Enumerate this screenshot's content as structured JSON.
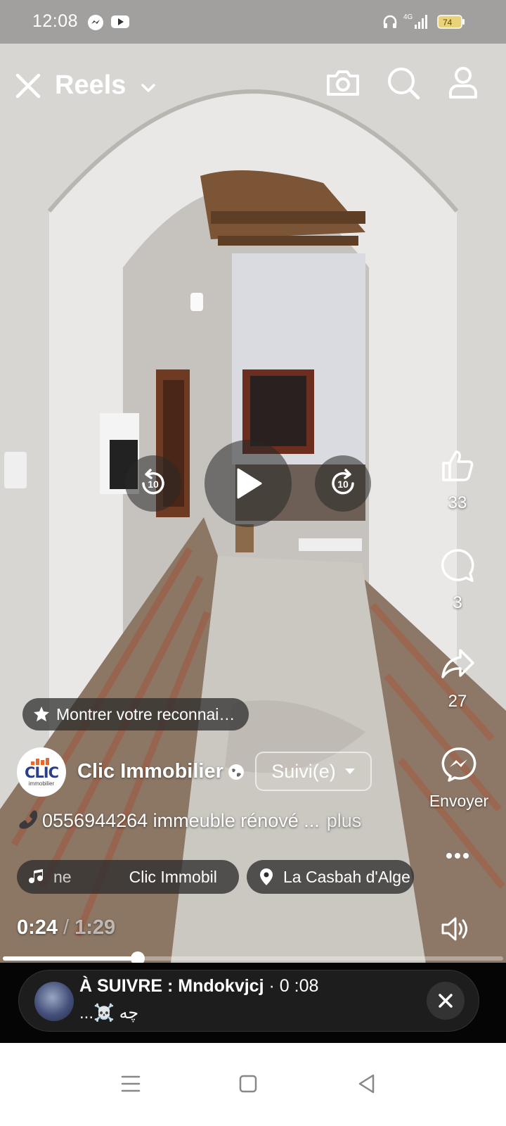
{
  "status_bar": {
    "time": "12:08",
    "network": "4G",
    "battery": "74"
  },
  "header": {
    "title": "Reels"
  },
  "player": {
    "current_time": "0:24",
    "separator": "/",
    "duration": "1:29",
    "progress_fraction": 0.27,
    "rewind_label": "10",
    "forward_label": "10"
  },
  "actions": {
    "like_count": "33",
    "comment_count": "3",
    "share_count": "27",
    "send_label": "Envoyer"
  },
  "recognition_chip": {
    "label": "Montrer votre reconnai…"
  },
  "author": {
    "avatar_text": "CLIC",
    "avatar_subtext": "immobilier",
    "name": "Clic Immobilier",
    "follow_label": "Suivi(e)"
  },
  "caption": {
    "text": "0556944264 immeuble rénové ...",
    "more": "plus"
  },
  "music_chip": {
    "scroll_text": "ne",
    "artist": "Clic Immobil"
  },
  "location_chip": {
    "label": "La Casbah d'Alge"
  },
  "up_next": {
    "label": "À SUIVRE : Mndokvjcj",
    "duration": "· 0 :08",
    "subtitle": "...☠️ چه"
  },
  "colors": {
    "accent": "#ffffff",
    "panel": "#1d1d1d",
    "chip_bg": "#2d2d2d"
  }
}
